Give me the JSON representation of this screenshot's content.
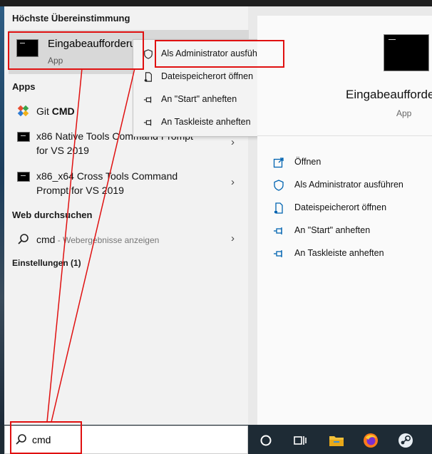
{
  "left_pane": {
    "best_match_heading": "Höchste Übereinstimmung",
    "best_match": {
      "title": "Eingabeaufforderu",
      "subtitle": "App"
    },
    "apps_heading": "Apps",
    "apps": [
      {
        "prefix": "Git ",
        "bold": "CMD",
        "line2": ""
      },
      {
        "prefix": "x86 Native Tools Command Prompt",
        "bold": "",
        "line2": "for VS 2019"
      },
      {
        "prefix": "x86_x64 Cross Tools Command",
        "bold": "",
        "line2": "Prompt for VS 2019"
      }
    ],
    "web_heading": "Web durchsuchen",
    "web_item": {
      "query": "cmd",
      "hint": " - Webergebnisse anzeigen"
    },
    "settings_heading": "Einstellungen (1)"
  },
  "context_menu": {
    "items": [
      {
        "label": "Als Administrator ausführen",
        "icon": "shield-icon"
      },
      {
        "label": "Dateispeicherort öffnen",
        "icon": "file-location-icon"
      },
      {
        "label": "An \"Start\" anheften",
        "icon": "pin-icon"
      },
      {
        "label": "An Taskleiste anheften",
        "icon": "pin-icon"
      }
    ]
  },
  "detail_pane": {
    "title": "Eingabeaufforde",
    "subtitle": "App",
    "actions": [
      {
        "label": "Öffnen",
        "icon": "open-icon"
      },
      {
        "label": "Als Administrator ausführen",
        "icon": "shield-icon"
      },
      {
        "label": "Dateispeicherort öffnen",
        "icon": "file-location-icon"
      },
      {
        "label": "An \"Start\" anheften",
        "icon": "pin-icon"
      },
      {
        "label": "An Taskleiste anheften",
        "icon": "pin-icon"
      }
    ]
  },
  "search": {
    "value": "cmd"
  },
  "taskbar": {
    "icons": [
      "cortana-icon",
      "task-view-icon",
      "file-explorer-icon",
      "firefox-icon",
      "steam-icon"
    ]
  },
  "colors": {
    "accent": "#0063b1",
    "annotation": "#e01010",
    "taskbar": "#1e2b35"
  }
}
